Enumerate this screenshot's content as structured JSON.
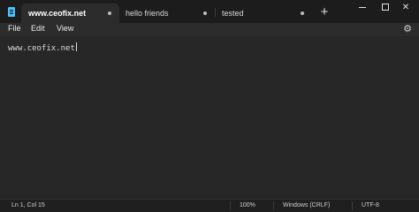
{
  "window": {
    "app_icon": "notepad-icon",
    "tabs": [
      {
        "label": "www.ceofix.net",
        "active": true,
        "unsaved_indicator": "dot"
      },
      {
        "label": "hello friends",
        "active": false,
        "unsaved_indicator": "dot"
      },
      {
        "label": "tested",
        "active": false,
        "unsaved_indicator": "dot"
      }
    ],
    "new_tab_label": "+",
    "controls": {
      "minimize": "minimize-icon",
      "maximize": "maximize-icon",
      "close_label": "✕"
    }
  },
  "menu": {
    "items": [
      "File",
      "Edit",
      "View"
    ],
    "settings_icon": "⚙"
  },
  "editor": {
    "content": "www.ceofix.net"
  },
  "status": {
    "position": "Ln 1, Col 15",
    "zoom": "100%",
    "line_ending": "Windows (CRLF)",
    "encoding": "UTF-8"
  },
  "colors": {
    "accent": "#4cc2ff",
    "background": "#202020",
    "editor_background": "#272727"
  }
}
